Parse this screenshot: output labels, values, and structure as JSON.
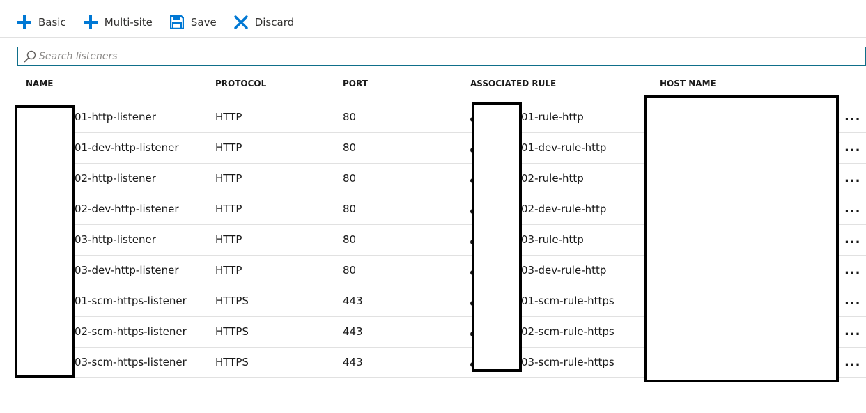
{
  "toolbar": {
    "basic_label": "Basic",
    "multisite_label": "Multi-site",
    "save_label": "Save",
    "discard_label": "Discard"
  },
  "search": {
    "placeholder": "Search listeners"
  },
  "table": {
    "headers": {
      "name": "NAME",
      "protocol": "PROTOCOL",
      "port": "PORT",
      "rule": "ASSOCIATED RULE",
      "host": "HOST NAME"
    },
    "rows": [
      {
        "name": "01-http-listener",
        "protocol": "HTTP",
        "port": "80",
        "rule": "01-rule-http"
      },
      {
        "name": "01-dev-http-listener",
        "protocol": "HTTP",
        "port": "80",
        "rule": "01-dev-rule-http"
      },
      {
        "name": "02-http-listener",
        "protocol": "HTTP",
        "port": "80",
        "rule": "02-rule-http"
      },
      {
        "name": "02-dev-http-listener",
        "protocol": "HTTP",
        "port": "80",
        "rule": "02-dev-rule-http"
      },
      {
        "name": "03-http-listener",
        "protocol": "HTTP",
        "port": "80",
        "rule": "03-rule-http"
      },
      {
        "name": "03-dev-http-listener",
        "protocol": "HTTP",
        "port": "80",
        "rule": "03-dev-rule-http"
      },
      {
        "name": "01-scm-https-listener",
        "protocol": "HTTPS",
        "port": "443",
        "rule": "01-scm-rule-https"
      },
      {
        "name": "02-scm-https-listener",
        "protocol": "HTTPS",
        "port": "443",
        "rule": "02-scm-rule-https"
      },
      {
        "name": "03-scm-https-listener",
        "protocol": "HTTPS",
        "port": "443",
        "rule": "03-scm-rule-https"
      }
    ],
    "more_label": "..."
  },
  "colors": {
    "accent": "#0078d4",
    "search_border": "#0f6f8a",
    "divider": "#e1e1e1"
  }
}
